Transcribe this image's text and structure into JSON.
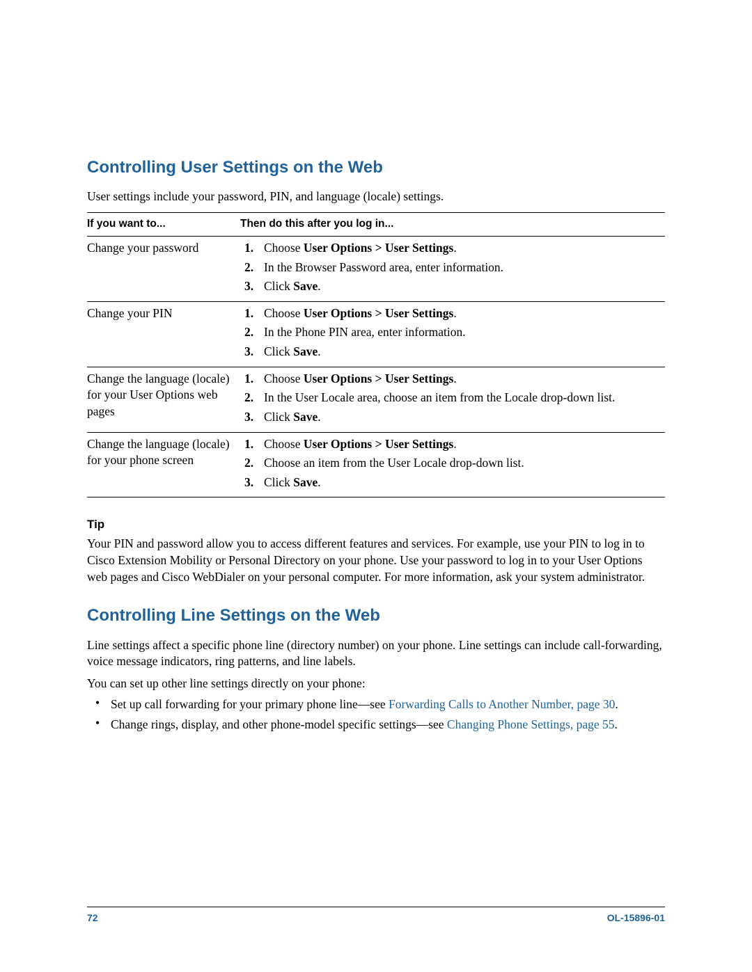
{
  "section1": {
    "heading": "Controlling User Settings on the Web",
    "intro": "User settings include your password, PIN, and language (locale) settings.",
    "th_left": "If you want to...",
    "th_right": "Then do this after you log in...",
    "nav_path": "User Options > User Settings",
    "choose_word": "Choose ",
    "click_word": "Click ",
    "save_word": "Save",
    "period": ".",
    "rows": [
      {
        "left": "Change your password",
        "step2": "In the Browser Password area, enter information."
      },
      {
        "left": "Change your PIN",
        "step2": "In the Phone PIN area, enter information."
      },
      {
        "left": "Change the language (locale) for your User Options web pages",
        "step2": "In the User Locale area, choose an item from the Locale drop-down list."
      },
      {
        "left": "Change the language (locale) for your phone screen",
        "step2": "Choose an item from the User Locale drop-down list."
      }
    ]
  },
  "tip": {
    "heading": "Tip",
    "body": "Your PIN and password allow you to access different features and services. For example, use your PIN to log in to Cisco Extension Mobility or Personal Directory on your phone. Use your password to log in to your User Options web pages and Cisco WebDialer on your personal computer. For more information, ask your system administrator."
  },
  "section2": {
    "heading": "Controlling Line Settings on the Web",
    "intro": "Line settings affect a specific phone line (directory number) on your phone. Line settings can include call-forwarding, voice message indicators, ring patterns, and line labels.",
    "lead": "You can set up other line settings directly on your phone:",
    "bullets": [
      {
        "pre": "Set up call forwarding for your primary phone line—see ",
        "link": "Forwarding Calls to Another Number, page 30",
        "post": "."
      },
      {
        "pre": "Change rings, display, and other phone-model specific settings—see ",
        "link": "Changing Phone Settings, page 55",
        "post": "."
      }
    ]
  },
  "footer": {
    "page_num": "72",
    "doc_id": "OL-15896-01"
  }
}
